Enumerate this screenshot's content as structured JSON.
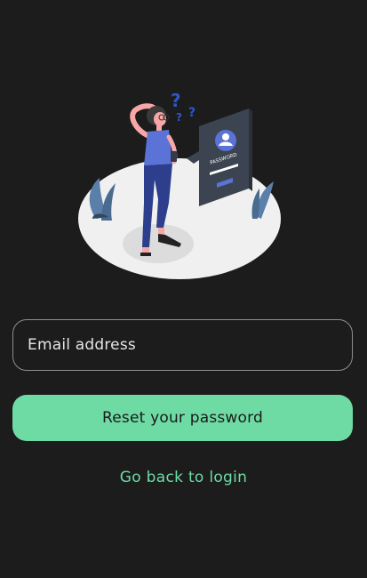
{
  "illustration": {
    "icon": "forgot-password-illustration",
    "card_label": "PASSWORD",
    "card_dots": "****"
  },
  "form": {
    "email_placeholder": "Email address"
  },
  "actions": {
    "reset_label": "Reset your password",
    "back_label": "Go back to login"
  },
  "colors": {
    "background": "#1c1c1c",
    "accent": "#6edba4",
    "field_border": "#8e8e8e",
    "text_light": "#e6e6e6"
  }
}
